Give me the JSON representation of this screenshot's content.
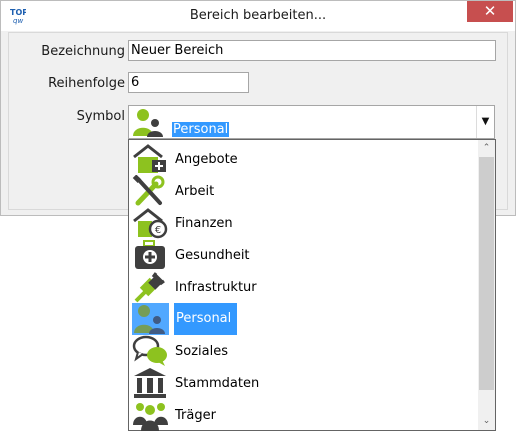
{
  "window": {
    "title": "Bereich bearbeiten...",
    "logo": {
      "top": "TOP",
      "bottom": "qw"
    },
    "close_symbol": "✕"
  },
  "form": {
    "name_label": "Bezeichnung",
    "name_value": "Neuer Bereich",
    "order_label": "Reihenfolge",
    "order_value": "6",
    "symbol_label": "Symbol"
  },
  "combo": {
    "selected_label": "Personal",
    "selected_icon": "personal-icon",
    "arrow": "▼"
  },
  "dropdown": {
    "items": [
      {
        "label": "Angebote",
        "icon": "house-plus-icon"
      },
      {
        "label": "Arbeit",
        "icon": "wrench-icon"
      },
      {
        "label": "Finanzen",
        "icon": "house-euro-icon"
      },
      {
        "label": "Gesundheit",
        "icon": "first-aid-kit-icon"
      },
      {
        "label": "Infrastruktur",
        "icon": "plug-icon"
      },
      {
        "label": "Personal",
        "icon": "personal-icon",
        "selected": true
      },
      {
        "label": "Soziales",
        "icon": "speech-bubbles-icon"
      },
      {
        "label": "Stammdaten",
        "icon": "institution-icon"
      },
      {
        "label": "Träger",
        "icon": "people-group-icon"
      }
    ],
    "scroll_up": "⌃",
    "scroll_down": "⌄"
  },
  "colors": {
    "accent_green": "#8dc21f",
    "icon_dark": "#3f3f3f",
    "selection_blue": "#3399ff",
    "close_red": "#c74f4f"
  }
}
